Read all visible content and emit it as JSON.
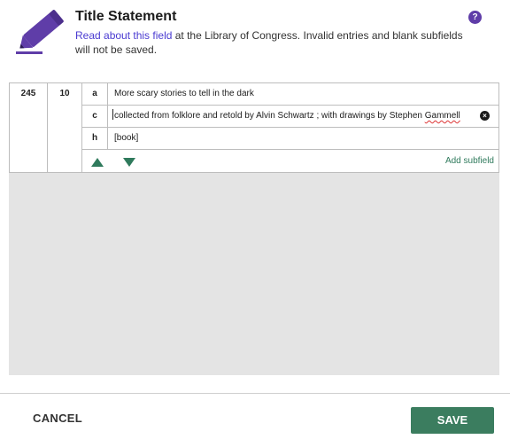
{
  "header": {
    "title": "Title Statement",
    "link_text": "Read about this field",
    "description_rest": " at the Library of Congress. Invalid entries and blank subfields will not be saved.",
    "help_label": "?",
    "pencil_icon": "pencil-icon",
    "accent_color": "#5f3da8"
  },
  "field": {
    "tag": "245",
    "indicators": "10",
    "subfields": [
      {
        "code": "a",
        "value": "More scary stories to tell in the dark"
      },
      {
        "code": "c",
        "value_main": "collected from folklore and retold by Alvin Schwartz ; with drawings by Stephen ",
        "value_misspelled": "Gammell"
      },
      {
        "code": "h",
        "value": "[book]"
      }
    ],
    "remove_label": "×",
    "add_subfield_label": "Add subfield",
    "control_color": "#2f7a5c"
  },
  "footer": {
    "cancel_label": "CANCEL",
    "save_label": "SAVE",
    "save_color": "#3b7d5f"
  }
}
